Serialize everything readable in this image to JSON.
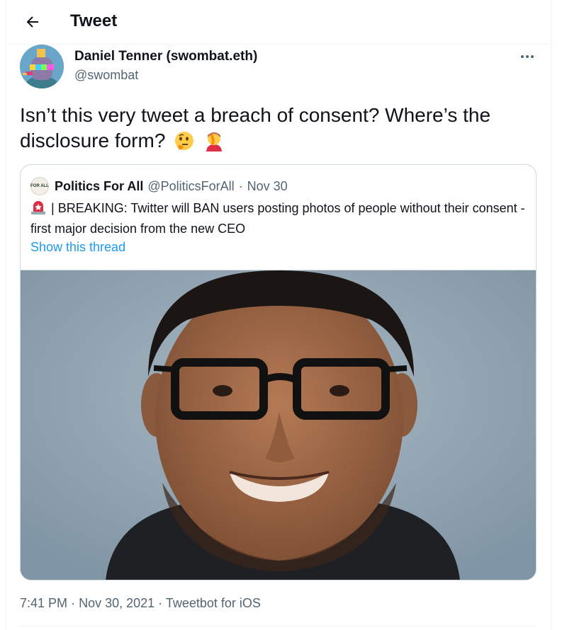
{
  "header": {
    "title": "Tweet",
    "back_icon": "arrow-left-icon"
  },
  "tweet": {
    "author_name": "Daniel Tenner (swombat.eth)",
    "author_handle": "@swombat",
    "text": "Isn’t this very tweet a breach of consent? Where’s the disclosure form?",
    "emojis": [
      "thinking-face-icon",
      "facepalm-icon"
    ],
    "more_icon": "more-horizontal-icon"
  },
  "quote": {
    "avatar_text": "FOR ALL",
    "name": "Politics For All",
    "handle": "@PoliticsForAll",
    "separator": "·",
    "date": "Nov 30",
    "text": "| BREAKING: Twitter will BAN users posting photos of people without their consent - first major decision from the new CEO",
    "show_thread": "Show this thread"
  },
  "meta": {
    "time": "7:41 PM",
    "separator": "·",
    "date": "Nov 30, 2021",
    "source": "Tweetbot for iOS"
  },
  "colors": {
    "link": "#1d9bf0",
    "secondary_text": "#536471",
    "border": "#cfd9de"
  }
}
